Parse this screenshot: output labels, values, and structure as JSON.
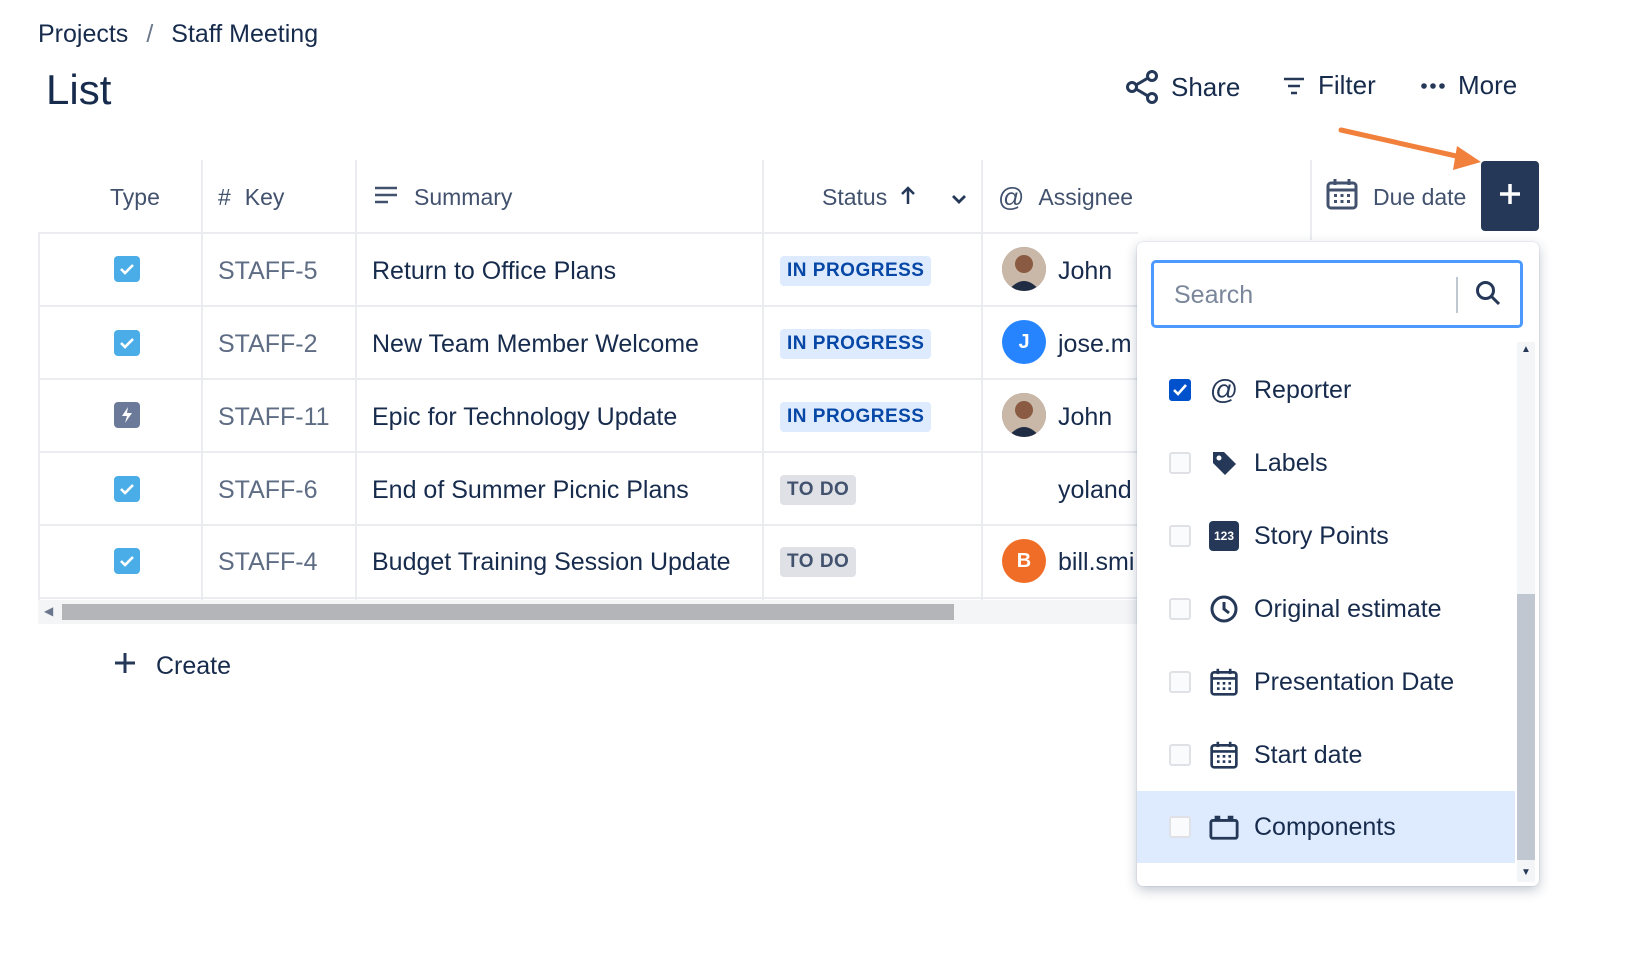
{
  "breadcrumb": {
    "project": "Projects",
    "separator": "/",
    "current": "Staff Meeting"
  },
  "page_title": "List",
  "toolbar": {
    "share": "Share",
    "filter": "Filter",
    "more": "More"
  },
  "columns": {
    "type": "Type",
    "key_hash": "#",
    "key": "Key",
    "summary": "Summary",
    "status": "Status",
    "assignee": "Assignee",
    "due_date": "Due date"
  },
  "rows": [
    {
      "type": "task",
      "key": "STAFF-5",
      "summary": "Return to Office Plans",
      "status": "IN PROGRESS",
      "assignee": "John",
      "avatar": "photo"
    },
    {
      "type": "task",
      "key": "STAFF-2",
      "summary": "New Team Member Welcome",
      "status": "IN PROGRESS",
      "assignee": "jose.m",
      "avatar_initial": "J"
    },
    {
      "type": "epic",
      "key": "STAFF-11",
      "summary": "Epic for Technology Update",
      "status": "IN PROGRESS",
      "assignee": "John",
      "avatar": "photo"
    },
    {
      "type": "task",
      "key": "STAFF-6",
      "summary": "End of Summer Picnic Plans",
      "status": "TO DO",
      "assignee": "yoland"
    },
    {
      "type": "task",
      "key": "STAFF-4",
      "summary": "Budget Training Session Update",
      "status": "TO DO",
      "assignee": "bill.smi",
      "avatar_initial": "B"
    }
  ],
  "create_label": "Create",
  "column_picker": {
    "search_placeholder": "Search",
    "items": [
      {
        "label": "Reporter",
        "checked": true,
        "icon": "at-icon"
      },
      {
        "label": "Labels",
        "checked": false,
        "icon": "tag-icon"
      },
      {
        "label": "Story Points",
        "checked": false,
        "icon": "number-123-icon",
        "icon_text": "123"
      },
      {
        "label": "Original estimate",
        "checked": false,
        "icon": "clock-icon"
      },
      {
        "label": "Presentation Date",
        "checked": false,
        "icon": "calendar-icon"
      },
      {
        "label": "Start date",
        "checked": false,
        "icon": "calendar-icon"
      },
      {
        "label": "Components",
        "checked": false,
        "icon": "component-icon"
      }
    ]
  },
  "colors": {
    "accent": "#0052cc",
    "dark_button": "#253858",
    "in_progress_bg": "#deebff",
    "todo_bg": "#dfe1e6",
    "annotation_arrow": "#f0803c"
  }
}
